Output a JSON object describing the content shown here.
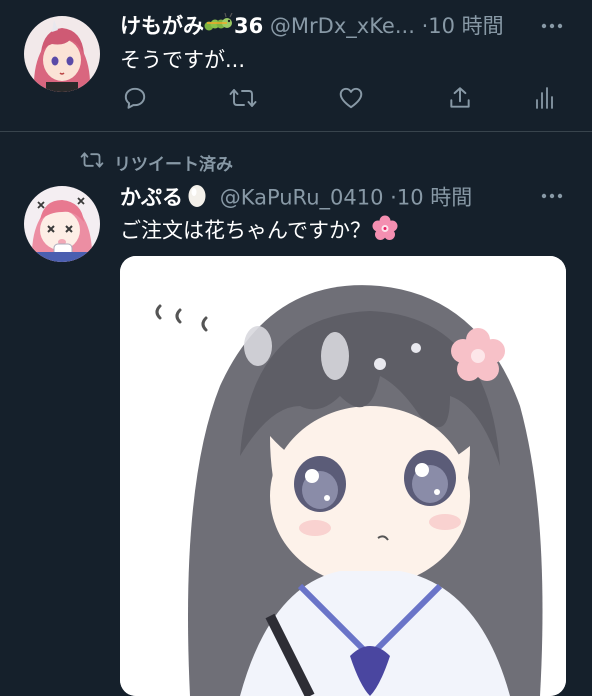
{
  "tweets": [
    {
      "display_name": "けもがみ",
      "name_suffix": "36",
      "handle": "@MrDx_xKe...",
      "separator": "·",
      "time": "10 時間",
      "text": "そうですが...",
      "avatar_icon": "anime-girl-pink-hair-avatar",
      "emoji_icon": "caterpillar-emoji"
    },
    {
      "retweet_label": "リツイート済み",
      "display_name": "かぷる",
      "handle": "@KaPuRu_0410",
      "separator": "·",
      "time": "10 時間",
      "text": "ご注文は花ちゃんですか？",
      "avatar_icon": "anime-girl-chibi-avatar",
      "emoji_icon": "egg-emoji",
      "text_emoji_icon": "cherry-blossom-emoji",
      "media_icon": "anime-girl-illustration"
    }
  ],
  "actions": [
    "reply-icon",
    "retweet-icon",
    "like-icon",
    "share-icon",
    "analytics-icon"
  ],
  "colors": {
    "background": "#15202b",
    "secondary_text": "#8899a6",
    "divider": "#38444d"
  }
}
